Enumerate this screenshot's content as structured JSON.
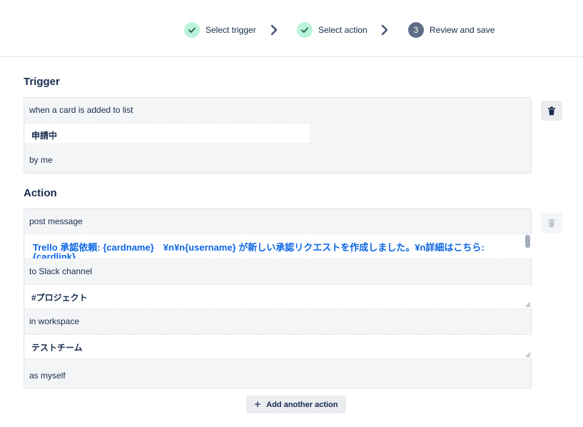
{
  "stepper": {
    "steps": [
      {
        "label": "Select trigger",
        "state": "done"
      },
      {
        "label": "Select action",
        "state": "done"
      },
      {
        "label": "Review and save",
        "state": "current",
        "number": "3"
      }
    ]
  },
  "trigger": {
    "title": "Trigger",
    "line1": "when a card is added to list",
    "list_value": "申請中",
    "line2": "by me"
  },
  "action": {
    "title": "Action",
    "line1": "post message",
    "message_value": "Trello 承認依頼: {cardname}　¥n¥n{username} が新しい承認リクエストを作成しました。¥n詳細はこちら: {cardlink}",
    "message_line1": "Trello 承認依頼: {cardname}　¥n¥n{username} が新しい承認リクエストを作成しました。¥n詳細はこちら:",
    "message_line2": "{cardlink}",
    "line2": "to Slack channel",
    "channel_value": "#プロジェクト",
    "line3": "in workspace",
    "workspace_value": "テストチーム",
    "line4": "as myself"
  },
  "buttons": {
    "add_action": "Add another action"
  },
  "icons": {
    "check": "check-icon",
    "chevron": "chevron-right-icon",
    "trash": "trash-icon",
    "plus": "plus-icon"
  },
  "colors": {
    "done_circle": "#baf3db",
    "current_circle": "#5e6c84",
    "link_blue": "#0c66e4"
  }
}
